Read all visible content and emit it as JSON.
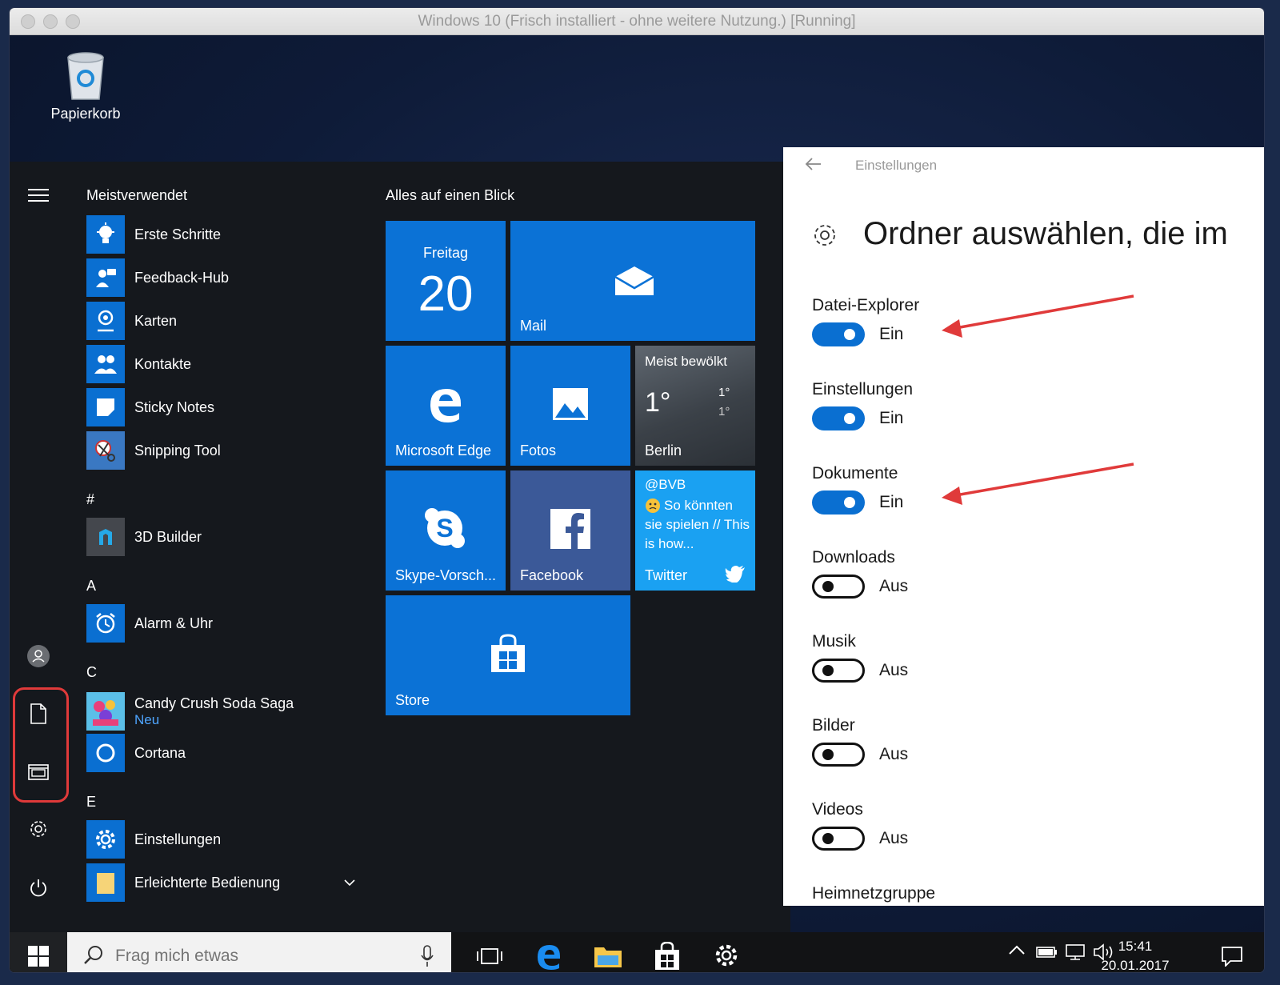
{
  "window": {
    "title": "Windows 10 (Frisch installiert - ohne weitere Nutzung.) [Running]"
  },
  "desktop": {
    "recycle_bin": "Papierkorb"
  },
  "start": {
    "most_used_header": "Meistverwendet",
    "tiles_header": "Alles auf einen Blick",
    "apps": [
      {
        "label": "Erste Schritte"
      },
      {
        "label": "Feedback-Hub"
      },
      {
        "label": "Karten"
      },
      {
        "label": "Kontakte"
      },
      {
        "label": "Sticky Notes"
      },
      {
        "label": "Snipping Tool"
      },
      {
        "label": "3D Builder"
      },
      {
        "label": "Alarm & Uhr"
      },
      {
        "label": "Candy Crush Soda Saga",
        "sub": "Neu"
      },
      {
        "label": "Cortana"
      },
      {
        "label": "Einstellungen"
      },
      {
        "label": "Erleichterte Bedienung"
      }
    ],
    "letters": [
      "#",
      "A",
      "C",
      "E"
    ],
    "tiles": {
      "calendar": {
        "day": "Freitag",
        "date": "20"
      },
      "mail": "Mail",
      "edge": "Microsoft Edge",
      "photos": "Fotos",
      "weather": {
        "condition": "Meist bewölkt",
        "temp": "1°",
        "high": "1°",
        "low": "1°",
        "city": "Berlin"
      },
      "skype": "Skype-Vorsch...",
      "facebook": "Facebook",
      "twitter": {
        "handle": "@BVB",
        "text": "So könnten sie spielen // This is how...",
        "label": "Twitter"
      },
      "store": "Store"
    }
  },
  "settings": {
    "caption": "Einstellungen",
    "title": "Ordner auswählen, die im",
    "items": [
      {
        "label": "Datei-Explorer",
        "state": "Ein",
        "on": true
      },
      {
        "label": "Einstellungen",
        "state": "Ein",
        "on": true
      },
      {
        "label": "Dokumente",
        "state": "Ein",
        "on": true
      },
      {
        "label": "Downloads",
        "state": "Aus",
        "on": false
      },
      {
        "label": "Musik",
        "state": "Aus",
        "on": false
      },
      {
        "label": "Bilder",
        "state": "Aus",
        "on": false
      },
      {
        "label": "Videos",
        "state": "Aus",
        "on": false
      },
      {
        "label": "Heimnetzgruppe"
      }
    ]
  },
  "taskbar": {
    "search_placeholder": "Frag mich etwas",
    "time": "15:41",
    "date": "20.01.2017"
  },
  "colors": {
    "accent": "#0a6fd1",
    "annotation": "#e03a3a"
  }
}
